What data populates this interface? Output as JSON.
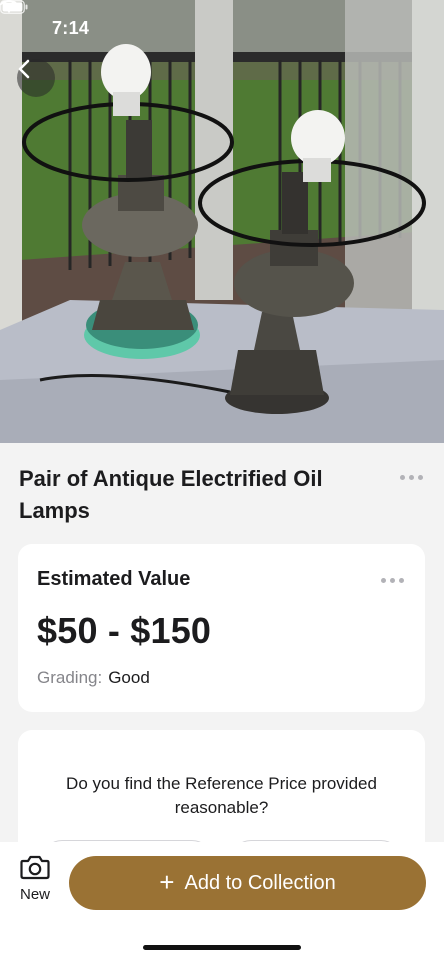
{
  "status_bar": {
    "time": "7:14",
    "icons": [
      "wifi-icon",
      "battery-icon"
    ]
  },
  "header": {
    "back_icon": "chevron-left-icon"
  },
  "item": {
    "title": "Pair of Antique Electrified Oil Lamps",
    "more_icon": "more-horizontal-icon"
  },
  "value_card": {
    "heading": "Estimated Value",
    "range": "$50 - $150",
    "grading_label": "Grading:",
    "grading_value": "Good",
    "more_icon": "more-horizontal-icon"
  },
  "feedback_card": {
    "question": "Do you find the Reference Price provided reasonable?"
  },
  "bottom_bar": {
    "new_label": "New",
    "new_icon": "camera-icon",
    "add_label": "Add to Collection",
    "add_icon": "plus-icon"
  },
  "colors": {
    "accent": "#9a7234",
    "background": "#f3f3f3",
    "card": "#ffffff",
    "muted_text": "#85858a"
  }
}
